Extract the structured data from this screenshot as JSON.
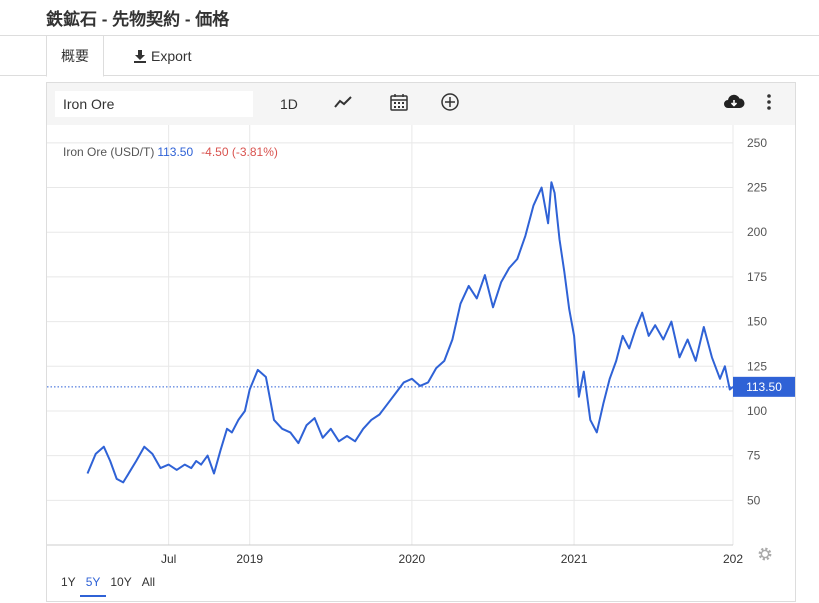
{
  "page": {
    "title": "鉄鉱石 - 先物契約 - 価格"
  },
  "tabs": {
    "overview": "概要",
    "export": "Export"
  },
  "toolbar": {
    "symbol": "Iron Ore",
    "period": "1D",
    "icons": [
      "line-chart-icon",
      "calendar-icon",
      "plus-circle-icon",
      "cloud-download-icon",
      "more-vertical-icon"
    ]
  },
  "legend": {
    "name": "Iron Ore (USD/T)",
    "price": "113.50",
    "change": "-4.50 (-3.81%)"
  },
  "ranges": [
    "1Y",
    "5Y",
    "10Y",
    "All"
  ],
  "active_range": "5Y",
  "colors": {
    "line": "#2f62d6",
    "negative": "#d9534f",
    "price_tag": "#2f62d6"
  },
  "chart_data": {
    "type": "line",
    "series": [
      {
        "name": "Iron Ore (USD/T)",
        "x": [
          2018.0,
          2018.05,
          2018.1,
          2018.14,
          2018.18,
          2018.22,
          2018.26,
          2018.3,
          2018.35,
          2018.4,
          2018.45,
          2018.5,
          2018.55,
          2018.6,
          2018.64,
          2018.67,
          2018.7,
          2018.74,
          2018.78,
          2018.82,
          2018.86,
          2018.89,
          2018.93,
          2018.97,
          2019.0,
          2019.05,
          2019.1,
          2019.15,
          2019.2,
          2019.25,
          2019.3,
          2019.35,
          2019.4,
          2019.45,
          2019.5,
          2019.55,
          2019.6,
          2019.65,
          2019.7,
          2019.75,
          2019.8,
          2019.85,
          2019.9,
          2019.95,
          2020.0,
          2020.05,
          2020.1,
          2020.15,
          2020.2,
          2020.25,
          2020.3,
          2020.35,
          2020.4,
          2020.45,
          2020.5,
          2020.55,
          2020.6,
          2020.65,
          2020.7,
          2020.75,
          2020.8,
          2020.84,
          2020.86,
          2020.88,
          2020.91,
          2020.94,
          2020.97,
          2021.0,
          2021.03,
          2021.06,
          2021.1,
          2021.14,
          2021.18,
          2021.22,
          2021.26,
          2021.3,
          2021.34,
          2021.38,
          2021.42,
          2021.46,
          2021.5,
          2021.55,
          2021.6,
          2021.65,
          2021.7,
          2021.75,
          2021.8,
          2021.85,
          2021.9,
          2021.93,
          2021.96,
          2021.98
        ],
        "y": [
          65,
          76,
          80,
          72,
          62,
          60,
          66,
          72,
          80,
          76,
          68,
          70,
          67,
          70,
          68,
          72,
          70,
          75,
          65,
          78,
          90,
          88,
          95,
          100,
          112,
          123,
          119,
          95,
          90,
          88,
          82,
          92,
          96,
          85,
          90,
          83,
          86,
          83,
          90,
          95,
          98,
          104,
          110,
          116,
          118,
          114,
          116,
          124,
          128,
          140,
          160,
          170,
          163,
          176,
          158,
          172,
          180,
          185,
          198,
          215,
          225,
          205,
          228,
          222,
          196,
          178,
          157,
          142,
          108,
          122,
          95,
          88,
          104,
          118,
          128,
          142,
          135,
          146,
          155,
          142,
          148,
          140,
          150,
          130,
          140,
          128,
          147,
          130,
          118,
          125,
          112,
          113.5
        ]
      }
    ],
    "xlabel": "",
    "ylabel": "",
    "x_ticks": [
      "Jul",
      "2019",
      "2020",
      "2021",
      "202"
    ],
    "y_ticks": [
      50,
      75,
      100,
      125,
      150,
      175,
      200,
      225,
      250
    ],
    "ylim": [
      25,
      260
    ],
    "last_value_label": "113.50",
    "grid": true,
    "y_axis_side": "right"
  }
}
